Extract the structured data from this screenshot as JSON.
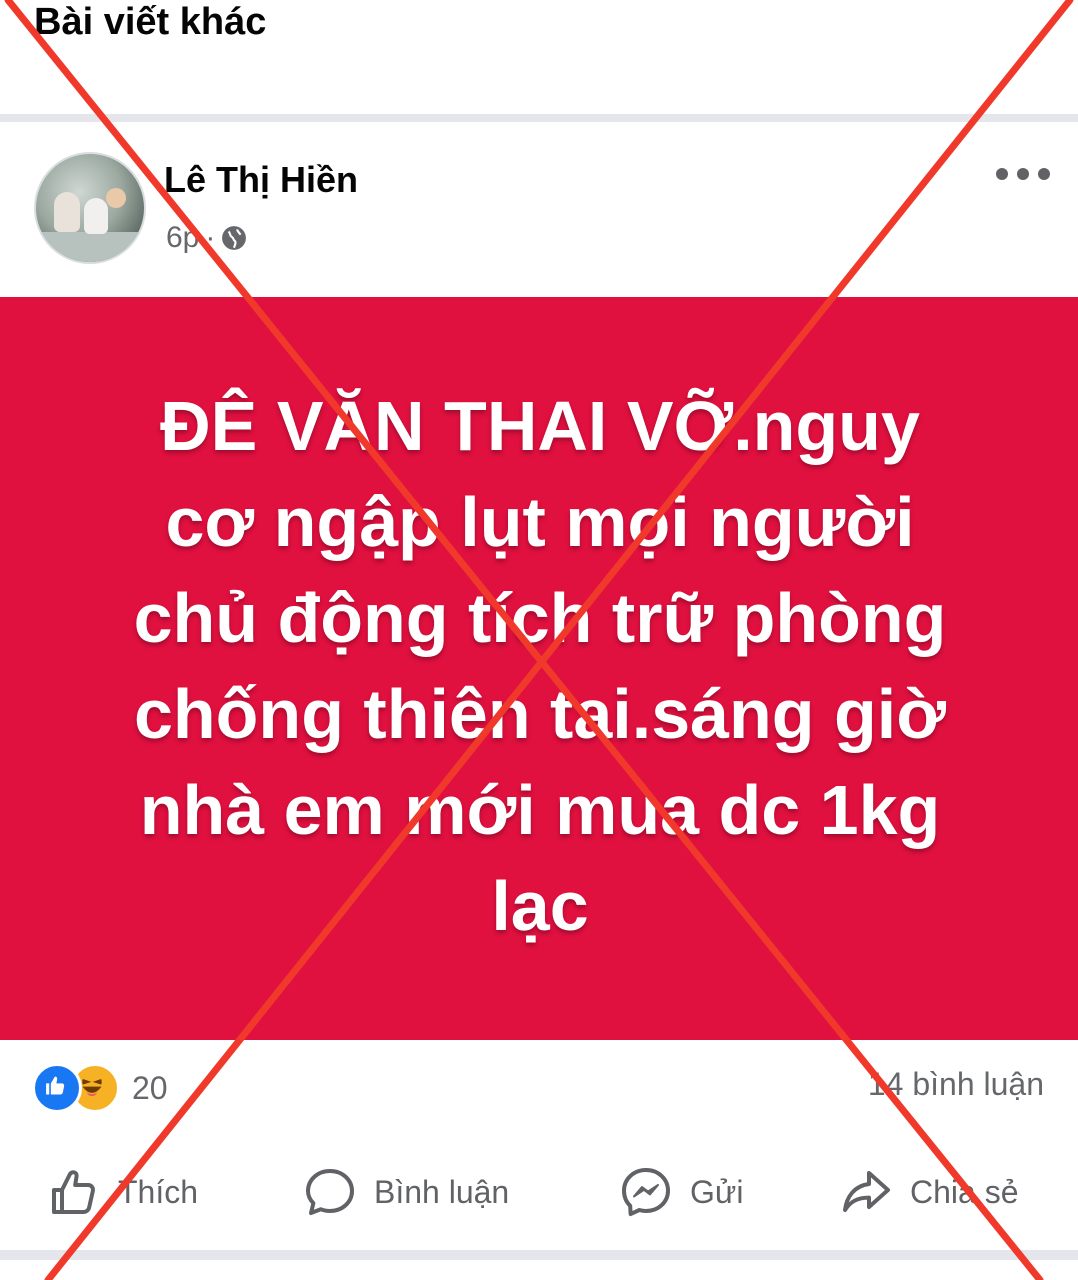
{
  "header": {
    "title": "Bài viết khác"
  },
  "post": {
    "author": "Lê Thị Hiền",
    "time": "6p",
    "separator": "·",
    "privacy_icon": "globe-icon",
    "menu_icon": "more-horizontal-icon",
    "card": {
      "background": "#e0103f",
      "lines": [
        "ĐÊ VĂN THAI VỠ.nguy",
        "cơ ngập lụt mọi người",
        "chủ động tích trữ phòng",
        "chống thiên tai.sáng giờ",
        "nhà em mới mua dc 1kg",
        "lạc"
      ]
    },
    "reactions": {
      "icons": [
        "like-reaction-icon",
        "haha-reaction-icon"
      ],
      "count": "20"
    },
    "comments_count": "14 bình luận",
    "actions": [
      {
        "label": "Thích",
        "icon": "thumbs-up-icon"
      },
      {
        "label": "Bình luận",
        "icon": "comment-icon"
      },
      {
        "label": "Gửi",
        "icon": "messenger-icon"
      },
      {
        "label": "Chia sẻ",
        "icon": "share-icon"
      }
    ]
  },
  "overlay": {
    "mark": "red-x-cross",
    "color": "#f0392b"
  }
}
